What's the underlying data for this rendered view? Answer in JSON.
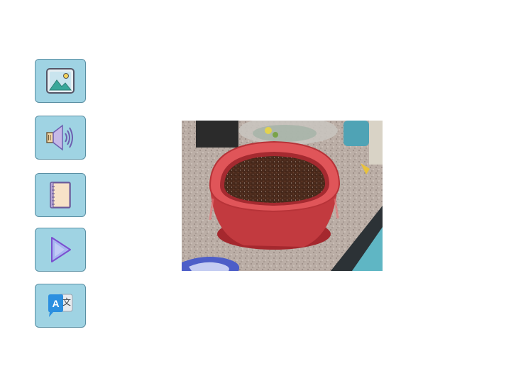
{
  "toolbar": {
    "buttons": [
      {
        "id": "image",
        "icon": "image-icon"
      },
      {
        "id": "audio",
        "icon": "speaker-icon"
      },
      {
        "id": "book",
        "icon": "book-icon"
      },
      {
        "id": "play",
        "icon": "play-icon"
      },
      {
        "id": "translate",
        "icon": "translate-icon"
      }
    ],
    "translate_glyph_latin": "A",
    "translate_glyph_cjk": "文"
  },
  "main": {
    "photo": {
      "subject": "pot-of-soil-photo"
    }
  },
  "colors": {
    "button_fill": "#9fd3e3",
    "button_border": "#5a8fa3",
    "pot_red": "#d9474a",
    "soil": "#4a2a1c",
    "countertop": "#b9ada4"
  }
}
